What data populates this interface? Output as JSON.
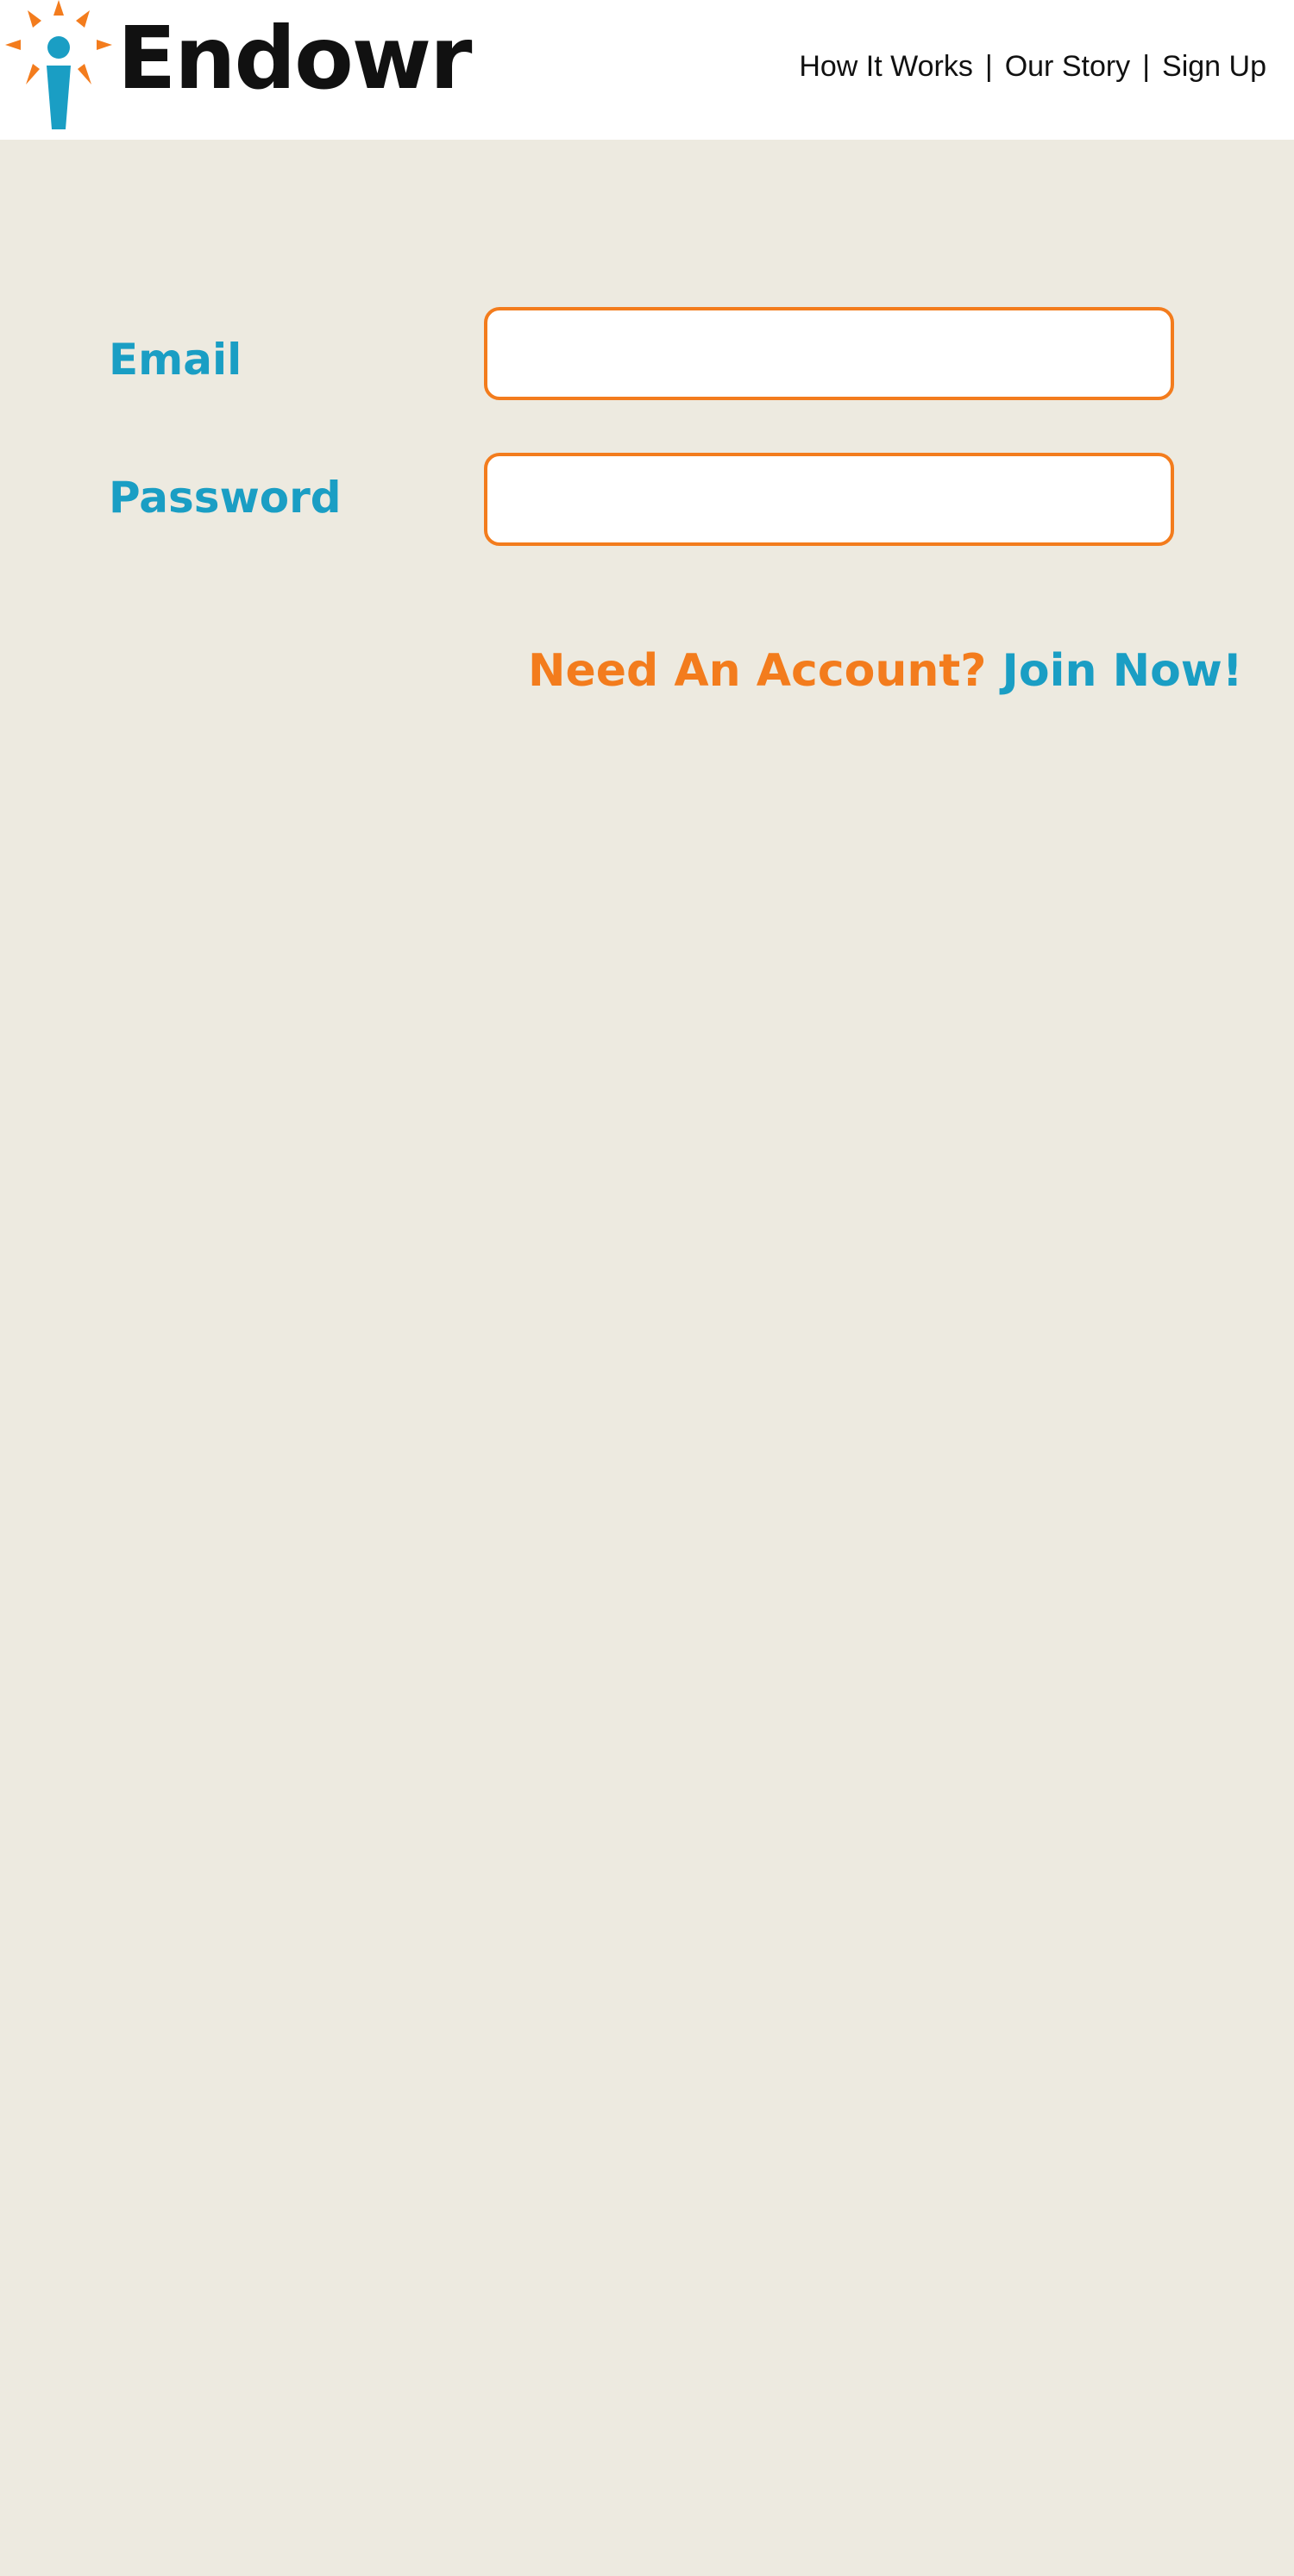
{
  "brand": {
    "name": "Endowr",
    "logo_icon": "person-sunburst-icon",
    "colors": {
      "orange": "#f37c1d",
      "blue": "#1a9ec4",
      "background": "#edeae0",
      "text": "#111111"
    }
  },
  "nav": {
    "items": [
      {
        "label": "How It Works"
      },
      {
        "label": "Our Story"
      },
      {
        "label": "Sign Up"
      }
    ],
    "separator": "|"
  },
  "login_form": {
    "email_label": "Email",
    "email_value": "",
    "password_label": "Password",
    "password_value": ""
  },
  "signup": {
    "prompt": "Need An Account?",
    "link": "Join Now!"
  }
}
